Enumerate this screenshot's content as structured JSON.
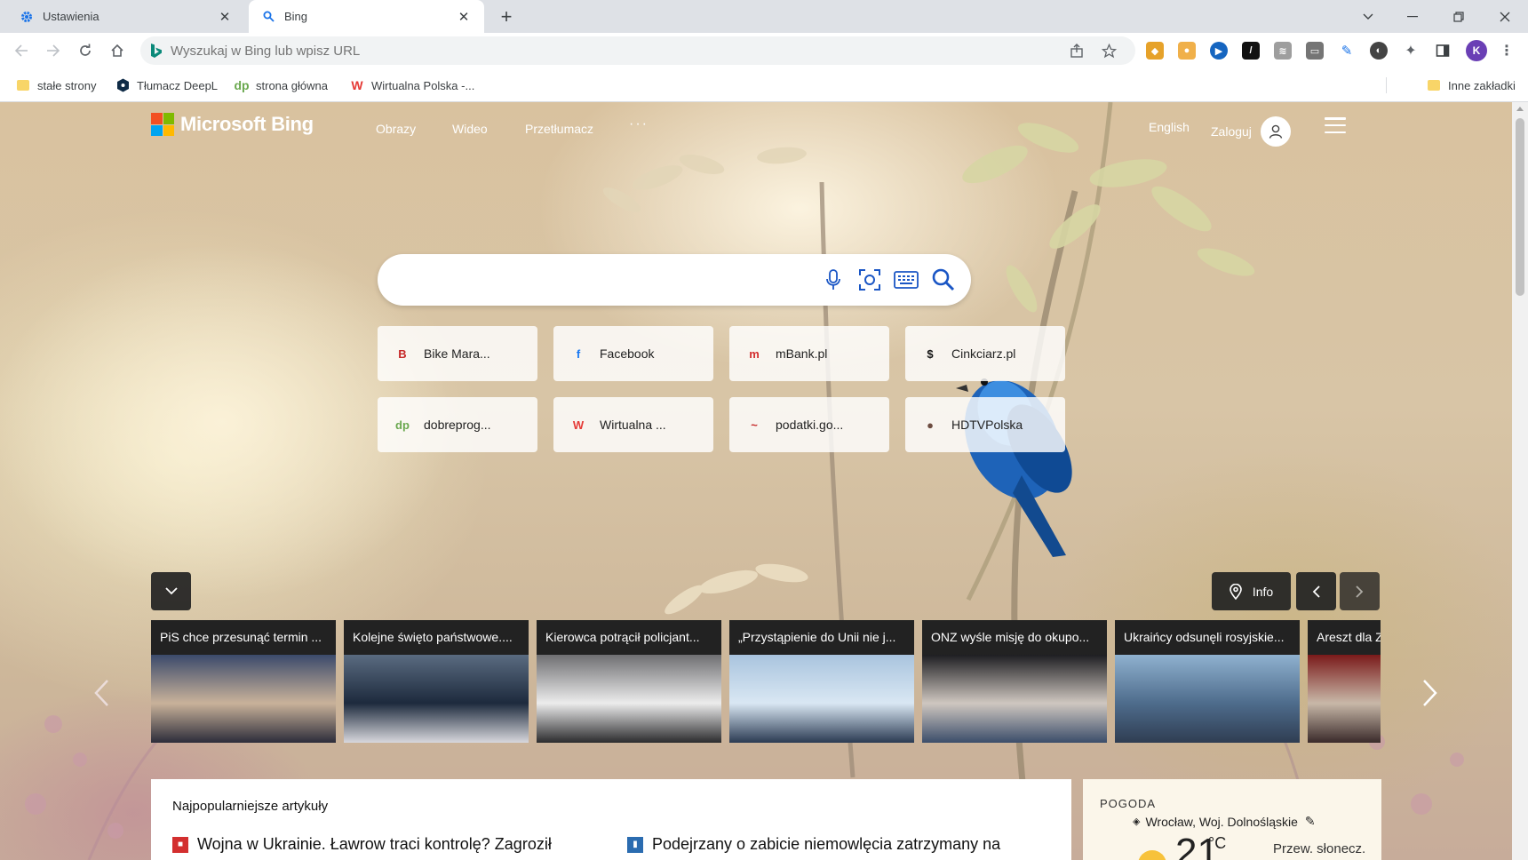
{
  "browser": {
    "tabs": [
      {
        "title": "Ustawienia",
        "icon": "gear-icon",
        "active": false
      },
      {
        "title": "Bing",
        "icon": "search-icon",
        "active": true
      }
    ],
    "address_placeholder": "Wyszukaj w Bing lub wpisz URL",
    "profile_initial": "K",
    "bookmarks": [
      {
        "label": "stałe strony",
        "icon": "folder-icon"
      },
      {
        "label": "Tłumacz DeepL",
        "icon": "deepl-icon"
      },
      {
        "label": "strona główna",
        "icon": "dp-icon",
        "icon_text": "dp"
      },
      {
        "label": "Wirtualna Polska -...",
        "icon": "wp-icon",
        "icon_text": "W"
      }
    ],
    "other_bookmarks": "Inne zakładki"
  },
  "bing": {
    "logo_text": "Microsoft Bing",
    "nav": [
      "Obrazy",
      "Wideo",
      "Przetłumacz",
      "···"
    ],
    "language": "English",
    "signin": "Zaloguj",
    "quick_links": [
      {
        "label": "Bike Mara...",
        "icon_text": "B",
        "color": "#c62828"
      },
      {
        "label": "Facebook",
        "icon_text": "f",
        "color": "#1877f2"
      },
      {
        "label": "mBank.pl",
        "icon_text": "m",
        "color": "#d32f2f"
      },
      {
        "label": "Cinkciarz.pl",
        "icon_text": "$",
        "color": "#111111"
      },
      {
        "label": "dobreprog...",
        "icon_text": "dp",
        "color": "#6aa84f"
      },
      {
        "label": "Wirtualna ...",
        "icon_text": "W",
        "color": "#e53935"
      },
      {
        "label": "podatki.go...",
        "icon_text": "~",
        "color": "#c62828"
      },
      {
        "label": "HDTVPolska",
        "icon_text": "●",
        "color": "#6d4c41"
      }
    ],
    "info_label": "Info",
    "news": [
      {
        "title": "PiS chce przesunąć termin ...",
        "img": [
          "#3b4a6b",
          "#c9b29a",
          "#2c2c3a"
        ]
      },
      {
        "title": "Kolejne święto państwowe....",
        "img": [
          "#5a6b80",
          "#1d2a3d",
          "#d8d8dd"
        ]
      },
      {
        "title": "Kierowca potrącił policjant...",
        "img": [
          "#6f6f72",
          "#ececec",
          "#2b2b2d"
        ]
      },
      {
        "title": "„Przystąpienie do Unii nie j...",
        "img": [
          "#a9c4de",
          "#d9e7f3",
          "#2a3a52"
        ]
      },
      {
        "title": "ONZ wyśle misję do okupo...",
        "img": [
          "#1e1e22",
          "#cfc7c0",
          "#3b4d6a"
        ]
      },
      {
        "title": "Ukraińcy odsunęli rosyjskie...",
        "img": [
          "#8fb1cf",
          "#4e6c8c",
          "#2f3d52"
        ]
      },
      {
        "title": "Areszt dla Z...",
        "img": [
          "#7a1a1a",
          "#c8b8a8",
          "#3a2a2a"
        ]
      }
    ],
    "articles": {
      "title": "Najpopularniejsze artykuły",
      "items": [
        {
          "text": "Wojna w Ukrainie. Ławrow traci kontrolę? Zagroził",
          "icon_color": "#d32f2f"
        },
        {
          "text": "Podejrzany o zabicie niemowlęcia zatrzymany na",
          "icon_color": "#2b6cb0"
        }
      ]
    },
    "weather": {
      "label": "POGODA",
      "location": "Wrocław, Woj. Dolnośląskie",
      "temp": "21",
      "unit": "°C",
      "desc": "Przew. słonecz."
    }
  }
}
